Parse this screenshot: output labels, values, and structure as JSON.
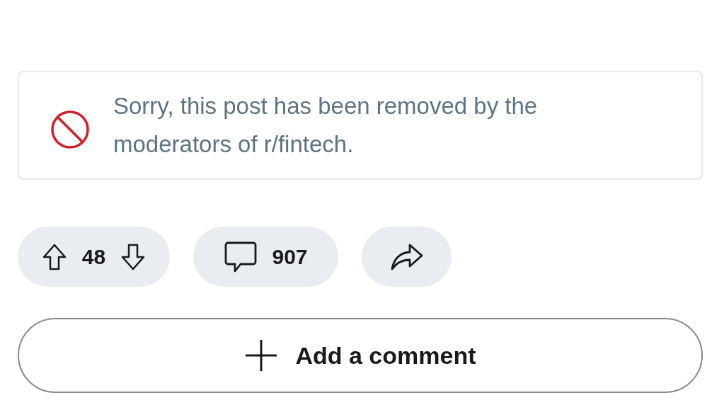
{
  "notice": {
    "message": "Sorry, this post has been removed by the moderators of r/fintech."
  },
  "actions": {
    "score": "48",
    "comments": "907"
  },
  "add_comment": {
    "label": "Add a comment"
  }
}
